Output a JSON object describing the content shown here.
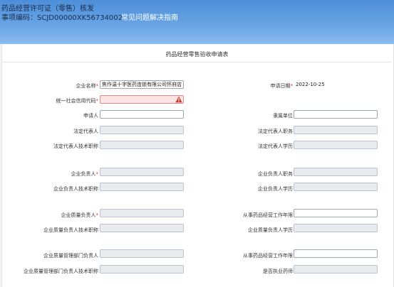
{
  "header": {
    "title": "药品经营许可证（零售）核发",
    "item_code": "事项编码：SCJD00000XK56734002",
    "faq_link": "常见问题解决指南"
  },
  "form": {
    "title": "药品经营零售验收申请表",
    "fields": {
      "company_name": {
        "label": "企业名称",
        "value": "焦作温十字医药连锁有限公司怀府店"
      },
      "apply_date": {
        "label": "申请日期",
        "value": "2022-10-25"
      },
      "credit_code": {
        "label": "统一社会信用代码",
        "value": ""
      },
      "applicant": {
        "label": "申请人",
        "value": ""
      },
      "affiliation": {
        "label": "隶属单位",
        "value": ""
      },
      "legal_rep": {
        "label": "法定代表人",
        "value": ""
      },
      "legal_rep_post": {
        "label": "法定代表人职务",
        "value": ""
      },
      "legal_rep_title": {
        "label": "法定代表人技术职称",
        "value": ""
      },
      "legal_rep_edu": {
        "label": "法定代表人学历",
        "value": ""
      },
      "manager": {
        "label": "企业负责人",
        "value": ""
      },
      "manager_post": {
        "label": "企业负责人职务",
        "value": ""
      },
      "manager_title": {
        "label": "企业负责人技术职称",
        "value": ""
      },
      "manager_edu": {
        "label": "企业负责人学历",
        "value": ""
      },
      "qa_manager": {
        "label": "企业质量负责人",
        "value": ""
      },
      "years_in_pharma": {
        "label": "从事药品经营工作年限",
        "value": ""
      },
      "qa_manager_title": {
        "label": "企业质量负责人技术职称",
        "value": ""
      },
      "qa_manager_edu": {
        "label": "企业质量负责人学历",
        "value": ""
      },
      "qa_dept_head": {
        "label": "企业质量管理部门负责人",
        "value": ""
      },
      "qa_dept_years": {
        "label": "从事药品经营工作年限",
        "value": ""
      },
      "qa_dept_head_title": {
        "label": "企业质量管理部门负责人技术职称",
        "value": ""
      },
      "licensed_pharmacist": {
        "label": "是否执业药师",
        "value": ""
      }
    }
  },
  "colors": {
    "header": "#5b9be0",
    "error_fill": "#fde5e5",
    "required_star": "#dd3333"
  }
}
